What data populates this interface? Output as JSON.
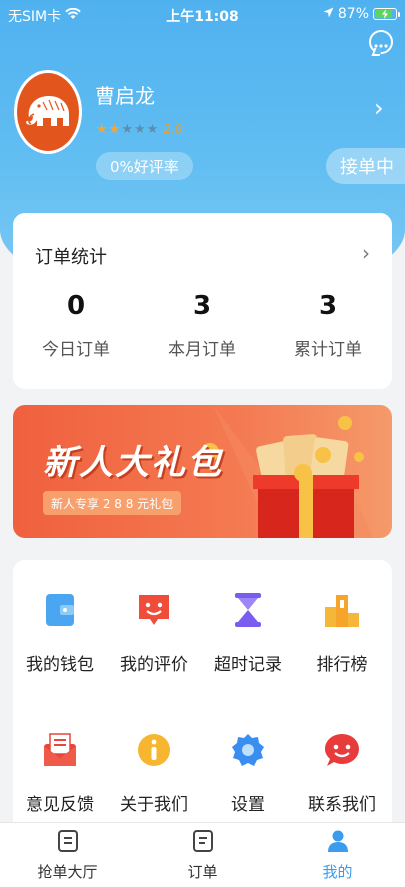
{
  "status_bar": {
    "carrier": "无SIM卡",
    "time": "上午11:08",
    "battery_text": "87%",
    "battery_level": 0.87
  },
  "profile": {
    "name": "曹启龙",
    "rating": 2,
    "rating_max": 5,
    "score": "2.0",
    "good_rate": "0%好评率",
    "status_button": "接单中"
  },
  "order_stats": {
    "title": "订单统计",
    "items": [
      {
        "value": "0",
        "label": "今日订单"
      },
      {
        "value": "3",
        "label": "本月订单"
      },
      {
        "value": "3",
        "label": "累计订单"
      }
    ]
  },
  "banner": {
    "title": "新人大礼包",
    "subtitle": "新人专享 2 8 8 元礼包"
  },
  "menu": {
    "items": [
      {
        "label": "我的钱包",
        "icon": "wallet-icon"
      },
      {
        "label": "我的评价",
        "icon": "review-icon"
      },
      {
        "label": "超时记录",
        "icon": "hourglass-icon"
      },
      {
        "label": "排行榜",
        "icon": "ranking-icon"
      },
      {
        "label": "意见反馈",
        "icon": "feedback-icon"
      },
      {
        "label": "关于我们",
        "icon": "info-icon"
      },
      {
        "label": "设置",
        "icon": "gear-icon"
      },
      {
        "label": "联系我们",
        "icon": "contact-icon"
      }
    ]
  },
  "tabbar": {
    "tabs": [
      {
        "label": "抢单大厅",
        "active": false
      },
      {
        "label": "订单",
        "active": false
      },
      {
        "label": "我的",
        "active": true
      }
    ]
  },
  "colors": {
    "header": "#4fb1ef",
    "accent_blue": "#3a9bef",
    "banner": "#f0603e",
    "star_on": "#f0a73a"
  }
}
